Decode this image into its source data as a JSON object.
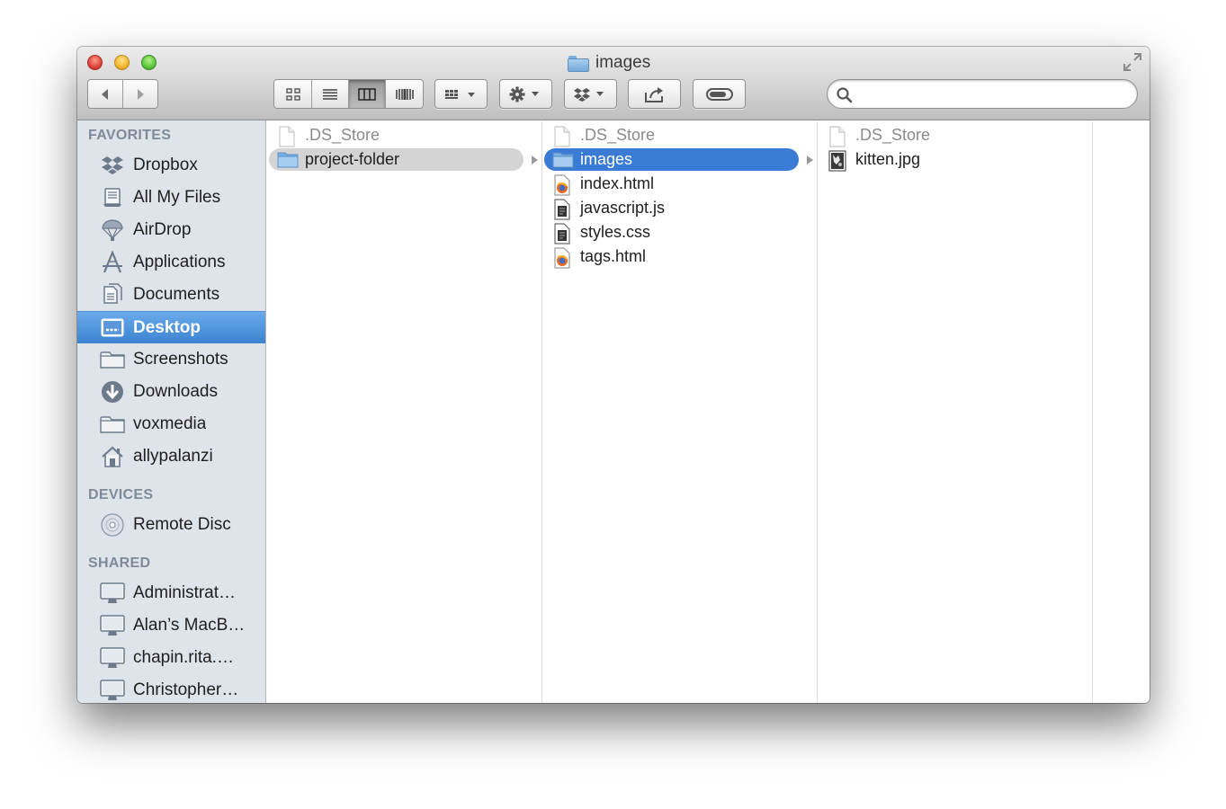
{
  "window": {
    "title": "images"
  },
  "search": {
    "value": "",
    "placeholder": ""
  },
  "sidebar": {
    "sections": [
      {
        "heading": "FAVORITES",
        "items": [
          {
            "label": "Dropbox",
            "icon": "dropbox-icon"
          },
          {
            "label": "All My Files",
            "icon": "all-my-files-icon"
          },
          {
            "label": "AirDrop",
            "icon": "airdrop-icon"
          },
          {
            "label": "Applications",
            "icon": "applications-icon"
          },
          {
            "label": "Documents",
            "icon": "documents-icon"
          },
          {
            "label": "Desktop",
            "icon": "desktop-icon",
            "selected": true
          },
          {
            "label": "Screenshots",
            "icon": "folder-icon"
          },
          {
            "label": "Downloads",
            "icon": "downloads-icon"
          },
          {
            "label": "voxmedia",
            "icon": "folder-icon"
          },
          {
            "label": "allypalanzi",
            "icon": "home-icon"
          }
        ]
      },
      {
        "heading": "DEVICES",
        "items": [
          {
            "label": "Remote Disc",
            "icon": "disc-icon"
          }
        ]
      },
      {
        "heading": "SHARED",
        "items": [
          {
            "label": "Administrat…",
            "icon": "computer-icon"
          },
          {
            "label": "Alan’s MacB…",
            "icon": "computer-icon"
          },
          {
            "label": "chapin.rita.…",
            "icon": "computer-icon"
          },
          {
            "label": "Christopher…",
            "icon": "computer-icon"
          }
        ]
      }
    ]
  },
  "columns": [
    [
      {
        "name": ".DS_Store",
        "kind": "blank",
        "dim": true
      },
      {
        "name": "project-folder",
        "kind": "folder",
        "selected": "inactive",
        "hasChildren": true
      }
    ],
    [
      {
        "name": ".DS_Store",
        "kind": "blank",
        "dim": true
      },
      {
        "name": "images",
        "kind": "folder",
        "selected": "active",
        "hasChildren": true
      },
      {
        "name": "index.html",
        "kind": "html"
      },
      {
        "name": "javascript.js",
        "kind": "script"
      },
      {
        "name": "styles.css",
        "kind": "script"
      },
      {
        "name": "tags.html",
        "kind": "html"
      }
    ],
    [
      {
        "name": ".DS_Store",
        "kind": "blank",
        "dim": true
      },
      {
        "name": "kitten.jpg",
        "kind": "image"
      }
    ]
  ],
  "colors": {
    "selection": "#3a7bd5",
    "sidebar_bg": "#dfe4ea",
    "sidebar_heading": "#7e8a99"
  }
}
